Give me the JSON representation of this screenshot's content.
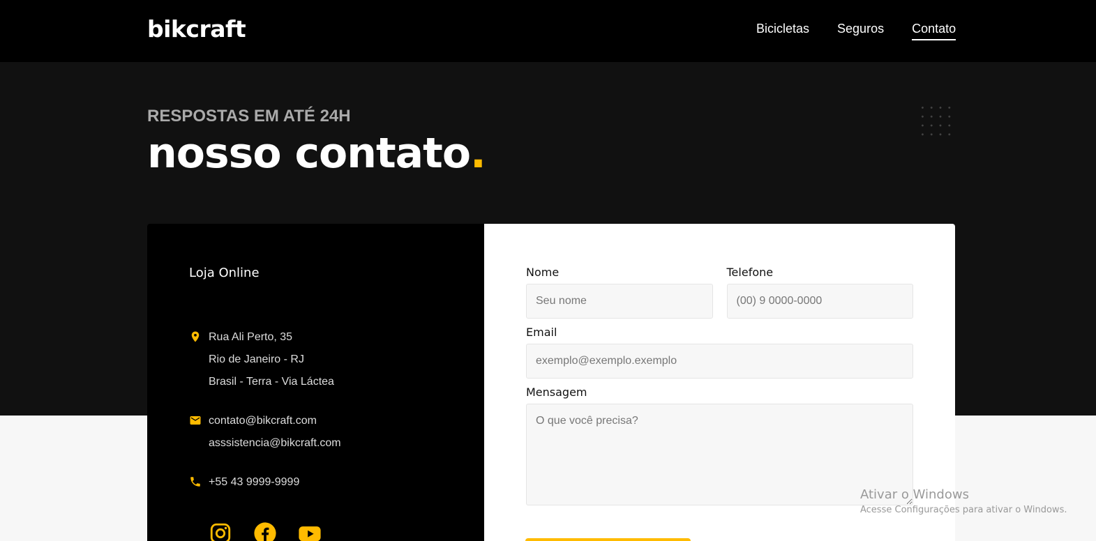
{
  "header": {
    "logo": "bikcraft",
    "nav": [
      {
        "label": "Bicicletas",
        "active": false
      },
      {
        "label": "Seguros",
        "active": false
      },
      {
        "label": "Contato",
        "active": true
      }
    ]
  },
  "hero": {
    "eyebrow": "RESPOSTAS EM ATÉ 24H",
    "title": "nosso contato",
    "title_dot": "."
  },
  "info": {
    "heading": "Loja Online",
    "address": [
      "Rua Ali Perto, 35",
      "Rio de Janeiro - RJ",
      "Brasil - Terra - Via Láctea"
    ],
    "emails": [
      "contato@bikcraft.com",
      "asssistencia@bikcraft.com"
    ],
    "phone": "+55 43 9999-9999",
    "icons": {
      "address": "location-pin-icon",
      "email": "mail-icon",
      "phone": "phone-icon"
    },
    "social": [
      "instagram-icon",
      "facebook-icon",
      "youtube-icon"
    ]
  },
  "form": {
    "nome": {
      "label": "Nome",
      "placeholder": "Seu nome"
    },
    "telefone": {
      "label": "Telefone",
      "placeholder": "(00) 9 0000-0000"
    },
    "email": {
      "label": "Email",
      "placeholder": "exemplo@exemplo.exemplo"
    },
    "mensagem": {
      "label": "Mensagem",
      "placeholder": "O que você precisa?"
    }
  },
  "watermark": {
    "line1": "Ativar o Windows",
    "line2": "Acesse Configurações para ativar o Windows."
  },
  "colors": {
    "accent": "#ffbb00",
    "dark": "#111111",
    "black": "#000000"
  }
}
